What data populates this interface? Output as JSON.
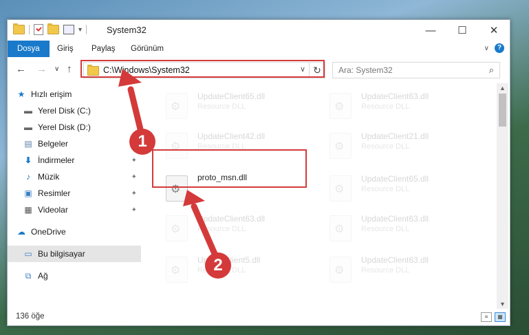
{
  "window": {
    "title": "System32",
    "minimize": "—",
    "maximize": "☐",
    "close": "✕"
  },
  "ribbon": {
    "tabs": [
      "Dosya",
      "Giriş",
      "Paylaş",
      "Görünüm"
    ]
  },
  "address": {
    "path": "C:\\Windows\\System32",
    "dropdown": "∨",
    "refresh": "↻"
  },
  "search": {
    "placeholder": "Ara: System32"
  },
  "nav": {
    "back": "←",
    "forward": "→",
    "recent": "∨",
    "up": "↑",
    "items": [
      {
        "label": "Hızlı erişim",
        "icon": "star-icon"
      },
      {
        "label": "Yerel Disk (C:)",
        "icon": "drive-icon"
      },
      {
        "label": "Yerel Disk (D:)",
        "icon": "drive-icon"
      },
      {
        "label": "Belgeler",
        "icon": "documents-icon"
      },
      {
        "label": "İndirmeler",
        "icon": "download-icon"
      },
      {
        "label": "Müzik",
        "icon": "music-icon"
      },
      {
        "label": "Resimler",
        "icon": "pictures-icon"
      },
      {
        "label": "Videolar",
        "icon": "videos-icon"
      },
      {
        "label": "OneDrive",
        "icon": "cloud-icon"
      },
      {
        "label": "Bu bilgisayar",
        "icon": "computer-icon"
      },
      {
        "label": "Ağ",
        "icon": "network-icon"
      }
    ]
  },
  "files": [
    {
      "name": "UpdateClient65.dll",
      "type": "Resource DLL"
    },
    {
      "name": "UpdateClient63.dll",
      "type": "Resource DLL"
    },
    {
      "name": "UpdateClient42.dll",
      "type": "Resource DLL"
    },
    {
      "name": "UpdateClient21.dll",
      "type": "Resource DLL"
    },
    {
      "name": "proto_msn.dll",
      "type": ""
    },
    {
      "name": "UpdateClient65.dll",
      "type": "Resource DLL"
    },
    {
      "name": "UpdateClient63.dll",
      "type": "Resource DLL"
    },
    {
      "name": "UpdateClient63.dll",
      "type": "Resource DLL"
    },
    {
      "name": "UpdateClient5.dll",
      "type": "Resource DLL"
    },
    {
      "name": "UpdateClient63.dll",
      "type": "Resource DLL"
    }
  ],
  "status": {
    "count": "136 öğe"
  },
  "annotations": {
    "step1": "1",
    "step2": "2",
    "color": "#d43a3a"
  }
}
